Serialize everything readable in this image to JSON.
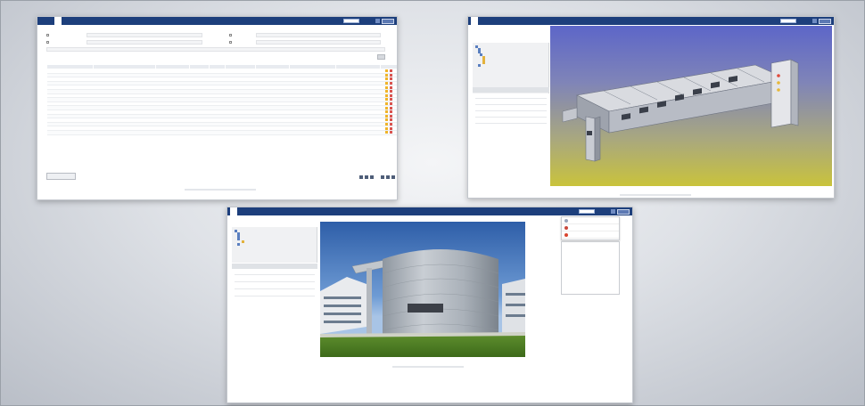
{
  "colors": {
    "nav": "#1d3f7c",
    "accent": "#5a8bc5",
    "status_red": "#cc4444",
    "edit_icon": "#f0b429",
    "delete_icon": "#d9534f"
  },
  "table_window": {
    "nav": {
      "tabs": [
        "",
        "",
        ""
      ],
      "search_placeholder": "",
      "links": [
        "",
        ""
      ]
    },
    "filters": [
      {
        "label": ""
      },
      {
        "label": ""
      },
      {
        "label": ""
      },
      {
        "label": ""
      }
    ],
    "columns": [
      "",
      "",
      "",
      "",
      "",
      "",
      "",
      "",
      "",
      ""
    ],
    "rows": [
      {
        "id": "",
        "cells": [
          "",
          "",
          "",
          "",
          "",
          "",
          "",
          ""
        ]
      },
      {
        "id": "",
        "cells": [
          "",
          "",
          "",
          "",
          "",
          "",
          "",
          ""
        ]
      },
      {
        "id": "",
        "cells": [
          "",
          "",
          "",
          "",
          "",
          "",
          "",
          ""
        ]
      },
      {
        "id": "",
        "cells": [
          "",
          "",
          "",
          "",
          "",
          "",
          "",
          ""
        ]
      },
      {
        "id": "",
        "cells": [
          "",
          "",
          "",
          "",
          "",
          "",
          "",
          ""
        ]
      },
      {
        "id": "",
        "cells": [
          "",
          "",
          "",
          "",
          "",
          "",
          "",
          ""
        ]
      },
      {
        "id": "",
        "cells": [
          "",
          "",
          "",
          "",
          "",
          "",
          "",
          ""
        ]
      },
      {
        "id": "",
        "cells": [
          "",
          "",
          "",
          "",
          "",
          "",
          "",
          ""
        ]
      },
      {
        "id": "",
        "cells": [
          "",
          "",
          "",
          "",
          "",
          "",
          "",
          ""
        ]
      },
      {
        "id": "",
        "cells": [
          "",
          "",
          "",
          "",
          "",
          "",
          "",
          ""
        ]
      },
      {
        "id": "",
        "cells": [
          "",
          "",
          "",
          "",
          "",
          "",
          "",
          ""
        ]
      },
      {
        "id": "",
        "cells": [
          "",
          "",
          "",
          "",
          "",
          "",
          "",
          ""
        ]
      },
      {
        "id": "",
        "cells": [
          "",
          "",
          "",
          "",
          "",
          "",
          "",
          ""
        ]
      },
      {
        "id": "",
        "cells": [
          "",
          "",
          "",
          "",
          "",
          "",
          "",
          ""
        ]
      },
      {
        "id": "",
        "cells": [
          "",
          "",
          "",
          "",
          "",
          "",
          "",
          ""
        ]
      },
      {
        "id": "",
        "cells": [
          "",
          "",
          "",
          "",
          "",
          "",
          "",
          ""
        ]
      }
    ],
    "new_button": "",
    "pager_label": ""
  },
  "model_window": {
    "nav": {
      "tabs": [
        "",
        ""
      ],
      "links": [
        "",
        ""
      ]
    },
    "tree": [
      "",
      "",
      "",
      "",
      "",
      "",
      "",
      ""
    ],
    "section_title": "",
    "properties": [
      {
        "key": "",
        "value": ""
      },
      {
        "key": "",
        "value": ""
      },
      {
        "key": "",
        "value": ""
      },
      {
        "key": "",
        "value": ""
      },
      {
        "key": "",
        "value": ""
      }
    ]
  },
  "photo_window": {
    "nav": {
      "tabs": [
        "",
        "",
        ""
      ],
      "links": [
        "",
        ""
      ]
    },
    "tree": [
      "",
      "",
      "",
      "",
      "",
      ""
    ],
    "section_title": "",
    "properties": [
      {
        "key": "",
        "value": ""
      },
      {
        "key": "",
        "value": ""
      },
      {
        "key": "",
        "value": ""
      },
      {
        "key": "",
        "value": ""
      }
    ],
    "context_menu": [
      "",
      "",
      ""
    ]
  }
}
